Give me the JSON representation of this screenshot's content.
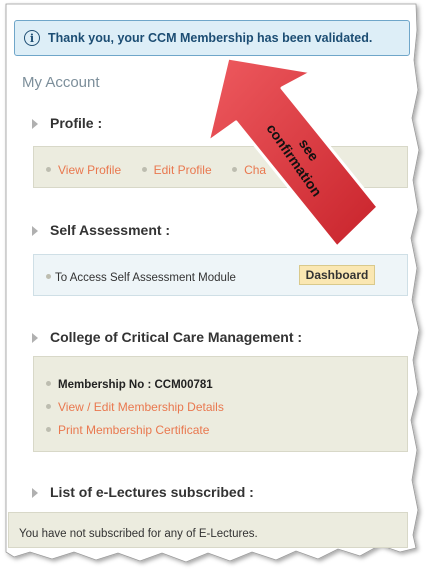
{
  "alert": {
    "message": "Thank you, your CCM Membership has been validated."
  },
  "account": {
    "title": "My Account"
  },
  "profile": {
    "title": "Profile :",
    "links": [
      "View Profile",
      "Edit Profile",
      "Cha"
    ]
  },
  "self_assessment": {
    "title": "Self Assessment :",
    "text": "To Access Self Assessment Module",
    "button": "Dashboard"
  },
  "college": {
    "title": "College of Critical Care Management :",
    "membership_no": "Membership No : CCM00781",
    "link_edit": "View / Edit Membership Details",
    "link_print": "Print Membership Certificate"
  },
  "lectures": {
    "title": "List of e-Lectures subscribed :",
    "text": "You have not subscribed for any of E-Lectures."
  },
  "annotation": {
    "line1": "see",
    "line2": "confirmation"
  },
  "colors": {
    "arrow_fill": "#d8323a",
    "alert_bg": "#ddeef7",
    "link": "#e9784f"
  }
}
